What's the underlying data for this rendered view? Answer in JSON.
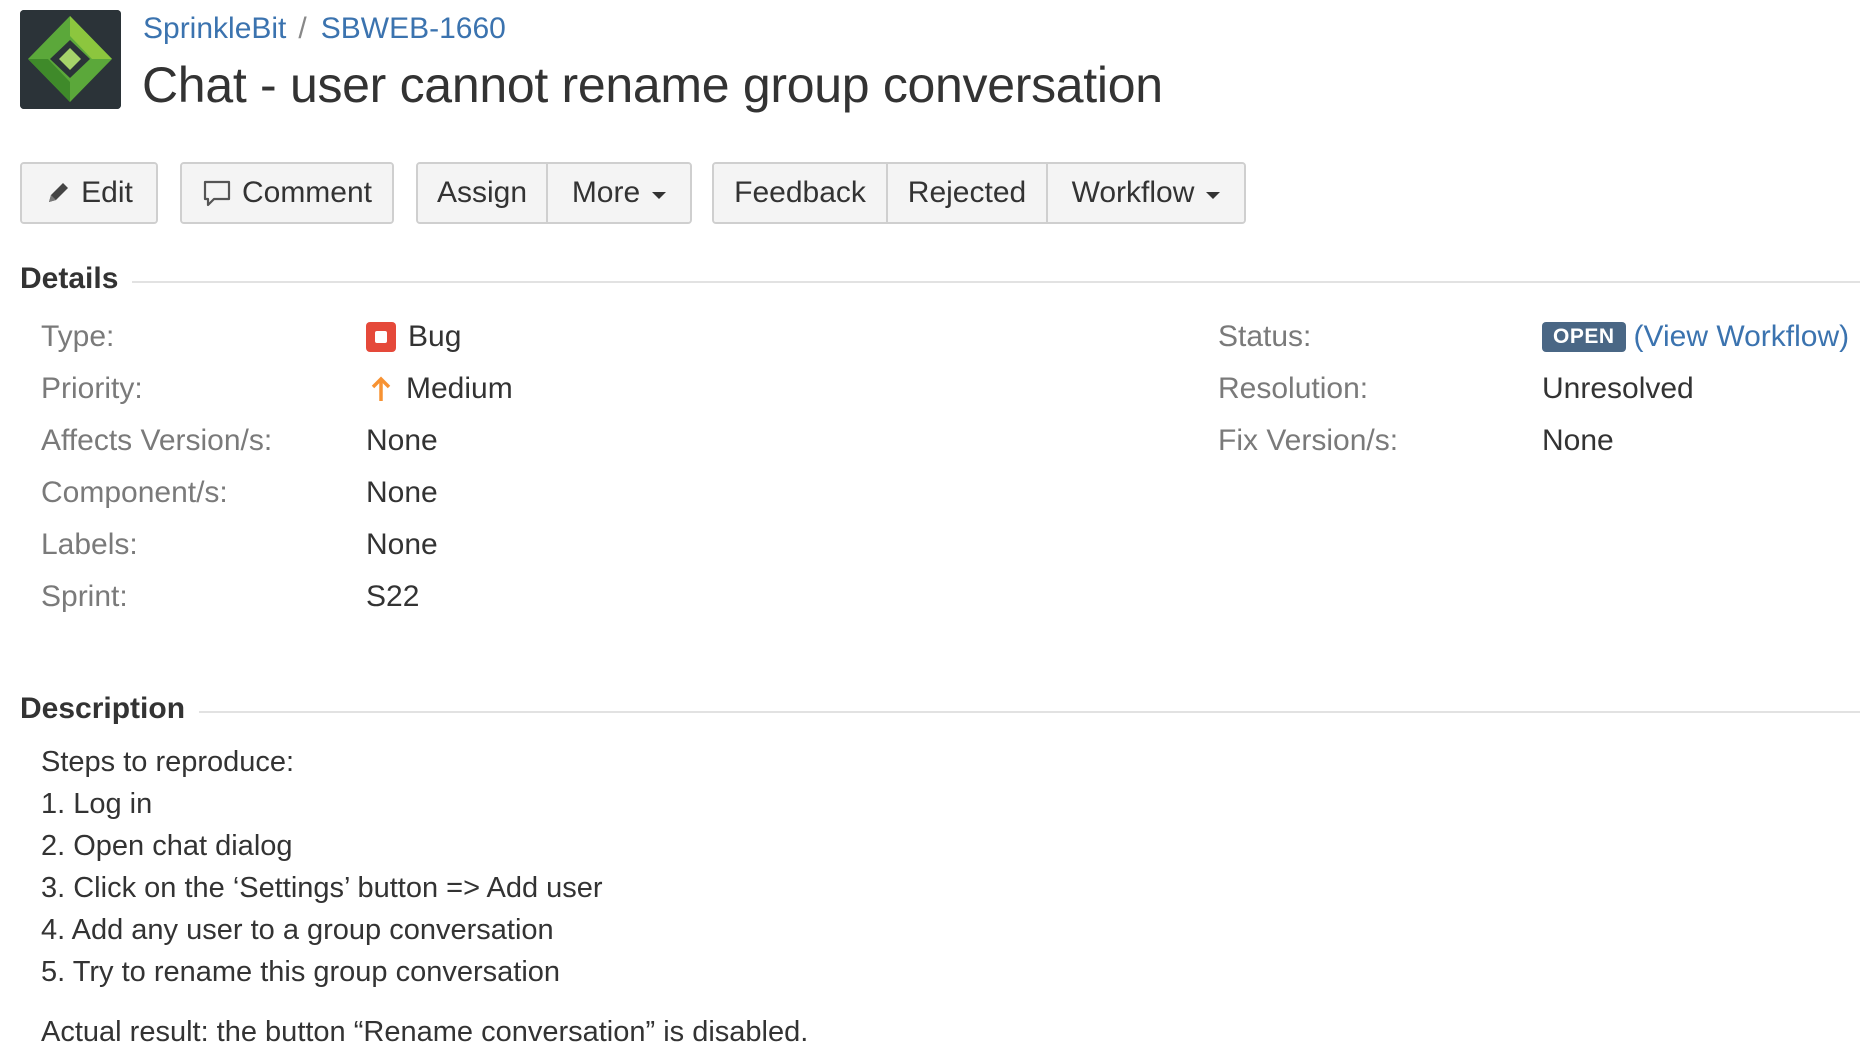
{
  "header": {
    "project": "SprinkleBit",
    "separator": "/",
    "issue_key": "SBWEB-1660",
    "title": "Chat - user cannot rename group conversation"
  },
  "toolbar": {
    "edit": "Edit",
    "comment": "Comment",
    "assign": "Assign",
    "more": "More",
    "feedback": "Feedback",
    "rejected": "Rejected",
    "workflow": "Workflow"
  },
  "details": {
    "heading": "Details",
    "left": [
      {
        "label": "Type:",
        "value": "Bug"
      },
      {
        "label": "Priority:",
        "value": "Medium"
      },
      {
        "label": "Affects Version/s:",
        "value": "None"
      },
      {
        "label": "Component/s:",
        "value": "None"
      },
      {
        "label": "Labels:",
        "value": "None"
      },
      {
        "label": "Sprint:",
        "value": "S22"
      }
    ],
    "right": {
      "status_label": "Status:",
      "status_value": "OPEN",
      "view_workflow": "(View Workflow)",
      "resolution_label": "Resolution:",
      "resolution_value": "Unresolved",
      "fix_label": "Fix Version/s:",
      "fix_value": "None"
    }
  },
  "description": {
    "heading": "Description",
    "lines": [
      "Steps to reproduce:",
      "1. Log in",
      "2. Open chat dialog",
      "3. Click on the ‘Settings’ button => Add user",
      "4. Add any user to a group conversation",
      "5. Try to rename this group conversation"
    ],
    "actual": "Actual result: the button “Rename conversation” is disabled."
  },
  "colors": {
    "link": "#3b73af",
    "status_open": "#4a6785",
    "bug": "#e5493a",
    "priority_medium": "#f79232",
    "logo_green": "#5ba83a"
  }
}
